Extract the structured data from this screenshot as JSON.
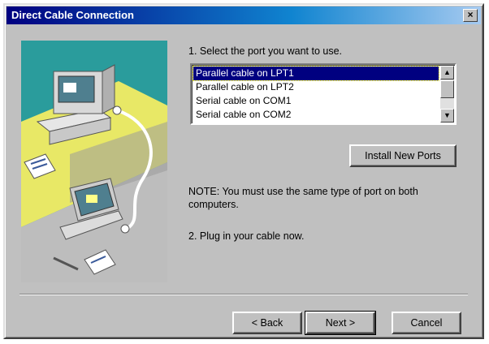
{
  "window": {
    "title": "Direct Cable Connection",
    "close_glyph": "×"
  },
  "step1": {
    "label": "1. Select the port you want to use.",
    "ports": [
      "Parallel cable on LPT1",
      "Parallel cable on LPT2",
      "Serial cable on COM1",
      "Serial cable on COM2"
    ],
    "selected_index": 0,
    "scroll_up": "▲",
    "scroll_down": "▼"
  },
  "install_button": "Install New Ports",
  "note": "NOTE: You must use the same type of port on both computers.",
  "step2": "2. Plug in your cable now.",
  "buttons": {
    "back": "< Back",
    "next": "Next >",
    "cancel": "Cancel"
  },
  "icons": [
    "desktop-computer-icon",
    "laptop-icon",
    "cable-icon",
    "document-icon"
  ],
  "colors": {
    "title_start": "#000080",
    "title_end": "#a6caf0",
    "art_bg": "#2a9c9c",
    "art_floor": "#e8e866",
    "face": "#c0c0c0"
  }
}
